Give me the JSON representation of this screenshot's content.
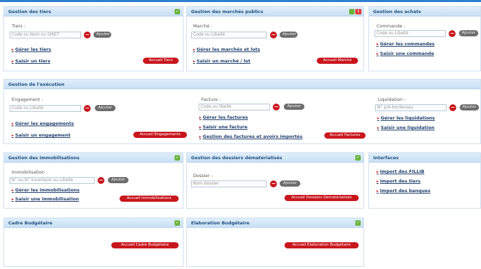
{
  "tiers": {
    "title": "Gestion des tiers",
    "field_label": "Tiers :",
    "placeholder": "Code ou Nom ou SIRET",
    "add_label": "Ajouter",
    "links": [
      "Gérer les tiers",
      "Saisir un tiers"
    ],
    "home_button": "Accueil Tiers"
  },
  "marches": {
    "title": "Gestion des marchés publics",
    "field_label": "Marché :",
    "placeholder": "Code ou Libellé",
    "add_label": "Ajouter",
    "links": [
      "Gérer les marchés et lots",
      "Saisir un marché / lot"
    ],
    "home_button": "Accueil Marché"
  },
  "achats": {
    "title": "Gestion des achats",
    "field_label": "Commande :",
    "placeholder": "Code ou Libellé",
    "add_label": "Ajouter",
    "links": [
      "Gérer les commandes",
      "Saisir une commande"
    ]
  },
  "execution": {
    "title": "Gestion de l'exécution",
    "engagement": {
      "field_label": "Engagement :",
      "placeholder": "Code ou Libellé",
      "add_label": "Ajouter",
      "links": [
        "Gérer les engagements",
        "Saisir un engagement"
      ],
      "home_button": "Accueil Engagements"
    },
    "facture": {
      "field_label": "Facture :",
      "placeholder": "Code ou libellé",
      "add_label": "Ajouter",
      "links": [
        "Gérer les factures",
        "Saisir une facture",
        "Gestion des factures et avoirs importés"
      ],
      "home_button": "Accueil Factures"
    },
    "liquidation": {
      "field_label": "Liquidation :",
      "placeholder": "N° pré-bordereau",
      "add_label": "Ajouter",
      "links": [
        "Gérer les liquidations",
        "Saisir une liquidation"
      ]
    }
  },
  "immobilisations": {
    "title": "Gestion des immobilisations",
    "field_label": "Immobilisation :",
    "placeholder": "N° ou N° inventaire ou Libellé",
    "add_label": "Ajouter",
    "links": [
      "Gérer les immobilisations",
      "Saisir une immobilisation"
    ],
    "home_button": "Accueil Immobilisations"
  },
  "dossiers": {
    "title": "Gestion des dossiers dématérialisés",
    "field_label": "Dossier :",
    "placeholder": "Nom dossier",
    "add_label": "Ajouter",
    "home_button": "Accueil Dossiers Dématérialisés"
  },
  "interfaces": {
    "title": "Interfaces",
    "links": [
      "Import des FILLIB",
      "Import des tiers",
      "Import des banques"
    ]
  },
  "cadre": {
    "title": "Cadre Budgétaire",
    "home_button": "Accueil Cadre Budgétaire"
  },
  "elaboration": {
    "title": "Elaboration Budgétaire",
    "home_button": "Accueil Elaboration Budgétaire"
  },
  "colors": {
    "header_text": "#1f4f7d",
    "accent_red": "#c8161d",
    "ok_green": "#6cb33e"
  }
}
